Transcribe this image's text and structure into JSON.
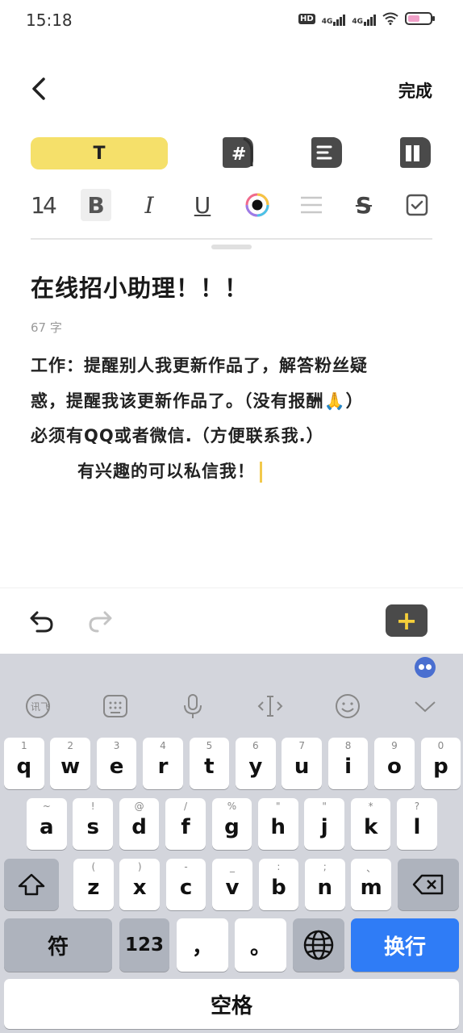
{
  "status_bar": {
    "time": "15:18",
    "hd": "HD",
    "signal1": "4G",
    "signal2": "4G"
  },
  "header": {
    "done_label": "完成"
  },
  "style_bar": {
    "text_style_label": "T"
  },
  "format_bar": {
    "font_size": "14",
    "bold": "B",
    "italic": "I",
    "underline": "U",
    "strike": "S"
  },
  "note": {
    "title": "在线招小助理！！！",
    "word_count": "67 字",
    "lines": [
      "工作：提醒别人我更新作品了，解答粉丝疑",
      "惑，提醒我该更新作品了。（没有报酬🙏）",
      "必须有QQ或者微信.（方便联系我.）",
      "有兴趣的可以私信我！"
    ]
  },
  "edit_bar": {
    "add_label": "+"
  },
  "keyboard": {
    "row1": [
      {
        "sub": "1",
        "key": "q"
      },
      {
        "sub": "2",
        "key": "w"
      },
      {
        "sub": "3",
        "key": "e"
      },
      {
        "sub": "4",
        "key": "r"
      },
      {
        "sub": "5",
        "key": "t"
      },
      {
        "sub": "6",
        "key": "y"
      },
      {
        "sub": "7",
        "key": "u"
      },
      {
        "sub": "8",
        "key": "i"
      },
      {
        "sub": "9",
        "key": "o"
      },
      {
        "sub": "0",
        "key": "p"
      }
    ],
    "row2": [
      {
        "sub": "~",
        "key": "a"
      },
      {
        "sub": "!",
        "key": "s"
      },
      {
        "sub": "@",
        "key": "d"
      },
      {
        "sub": "/",
        "key": "f"
      },
      {
        "sub": "%",
        "key": "g"
      },
      {
        "sub": "\"",
        "key": "h"
      },
      {
        "sub": "\"",
        "key": "j"
      },
      {
        "sub": "*",
        "key": "k"
      },
      {
        "sub": "?",
        "key": "l"
      }
    ],
    "row3": [
      {
        "sub": "(",
        "key": "z"
      },
      {
        "sub": ")",
        "key": "x"
      },
      {
        "sub": "-",
        "key": "c"
      },
      {
        "sub": "_",
        "key": "v"
      },
      {
        "sub": ":",
        "key": "b"
      },
      {
        "sub": ";",
        "key": "n"
      },
      {
        "sub": "、",
        "key": "m"
      }
    ],
    "symbol_key": "符",
    "numbers_key": "123",
    "comma_key": "，",
    "period_key": "。",
    "enter_key": "换行",
    "space_key": "空格"
  }
}
